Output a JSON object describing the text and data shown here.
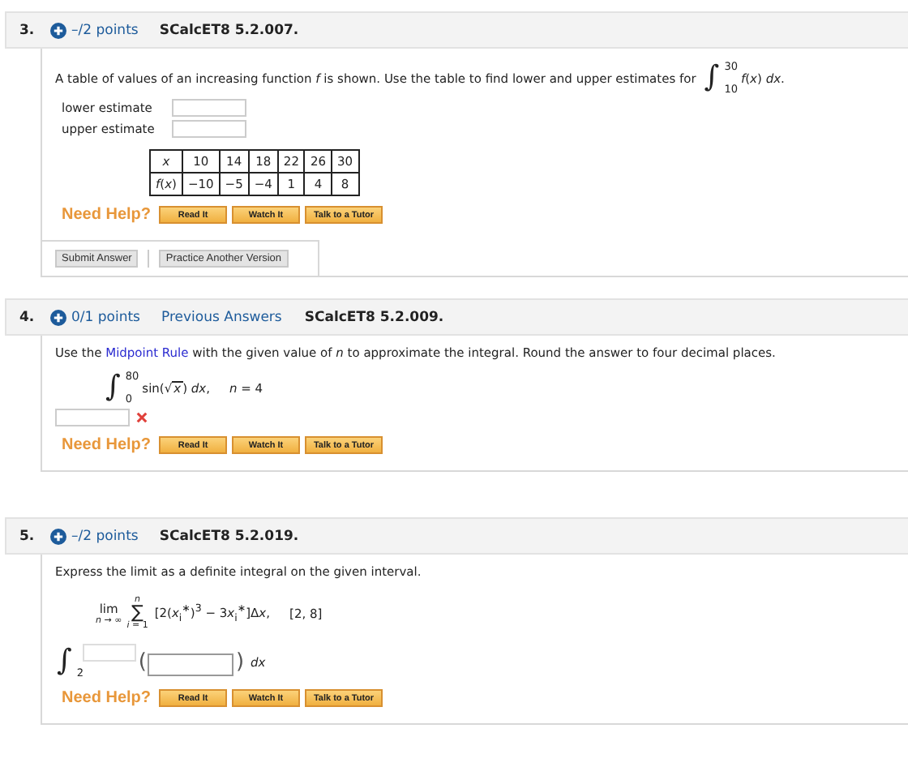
{
  "questions": [
    {
      "number": "3.",
      "points": "–/2 points",
      "code": "SCalcET8 5.2.007.",
      "kind": "table-estimates",
      "prompt": "A table of values of an increasing function *f* is shown. Use the table to find lower and upper estimates for",
      "integral": {
        "sign": "∫",
        "upper": "30",
        "lower": "10",
        "integrand": "*f*(*x*) *dx*."
      },
      "fields": [
        {
          "label": "lower estimate"
        },
        {
          "label": "upper estimate"
        }
      ],
      "table": {
        "rows": [
          [
            "*x*",
            "10",
            "14",
            "18",
            "22",
            "26",
            "30"
          ],
          [
            "*f*(*x*)",
            "−10",
            "−5",
            "−4",
            "1",
            "4",
            "8"
          ]
        ]
      },
      "help": {
        "label": "Need Help?",
        "buttons": [
          "Read It",
          "Watch It",
          "Talk to a Tutor"
        ]
      },
      "actions": [
        "Submit Answer",
        "Practice Another Version"
      ]
    },
    {
      "number": "4.",
      "points": "0/1 points",
      "link": "Previous Answers",
      "code": "SCalcET8 5.2.009.",
      "kind": "midpoint",
      "prompt": {
        "before": "Use the ",
        "link": "Midpoint Rule",
        "after": " with the given value of *n* to approximate the integral. Round the answer to four decimal places."
      },
      "integral": {
        "sign": "∫",
        "upper": "80",
        "lower": "0",
        "integrand_before": "sin(",
        "radical": "√",
        "radicand": "*x*",
        "integrand_after": ") *dx*,",
        "condition": "*n* = 4"
      },
      "answer": {
        "incorrect": true
      },
      "help": {
        "label": "Need Help?",
        "buttons": [
          "Read It",
          "Watch It",
          "Talk to a Tutor"
        ]
      }
    },
    {
      "number": "5.",
      "points": "–/2 points",
      "code": "SCalcET8 5.2.019.",
      "kind": "limit",
      "prompt": "Express the limit as a definite integral on the given interval.",
      "limit": {
        "lim": "lim",
        "approach": "*n* → ∞",
        "sum_upper": "*n*",
        "sigma": "∑",
        "sum_lower": "*i* = 1",
        "term": [
          "[2(*x*$_{i}$$^{∗}$)$^{3}$ − 3",
          "*x*$_{i}$$^{∗}$]Δ",
          "*x*,"
        ],
        "interval": "[2, 8]"
      },
      "answer": {
        "sign": "∫",
        "lower": "2",
        "open": "(",
        "close": ")",
        "dx": "*dx*"
      },
      "help": {
        "label": "Need Help?",
        "buttons": [
          "Read It",
          "Watch It",
          "Talk to a Tutor"
        ]
      }
    }
  ]
}
